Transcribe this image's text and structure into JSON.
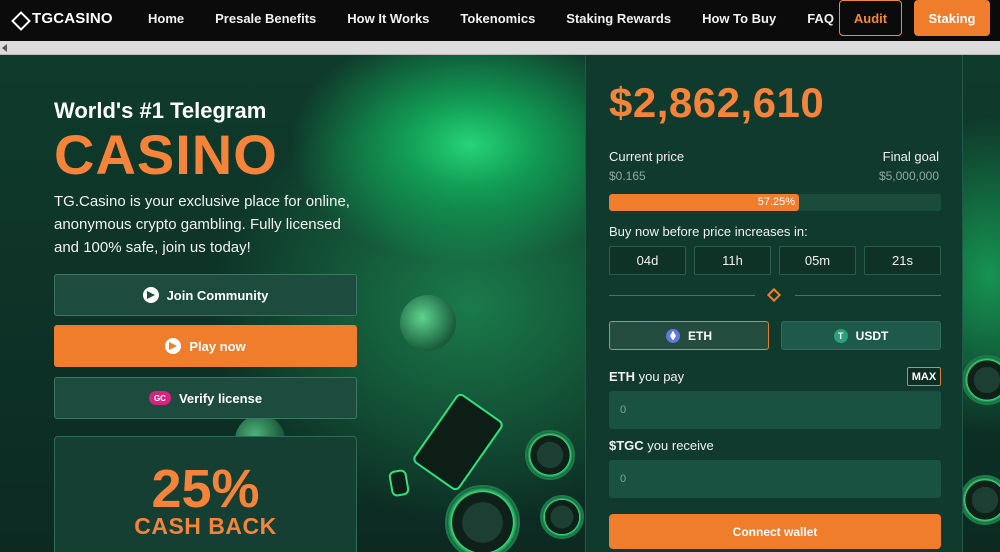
{
  "nav": {
    "logo": "TGCASINO",
    "links": [
      "Home",
      "Presale Benefits",
      "How It Works",
      "Tokenomics",
      "Staking Rewards",
      "How To Buy",
      "FAQ"
    ],
    "audit_label": "Audit",
    "staking_label": "Staking"
  },
  "hero": {
    "subtitle": "World's #1 Telegram",
    "title": "CASINO",
    "description": "TG.Casino is your exclusive place for online, anonymous crypto gambling. Fully licensed and 100% safe, join us today!",
    "join_label": "Join Community",
    "play_label": "Play now",
    "verify_label": "Verify license",
    "verify_icon_text": "GC",
    "cashback_pct": "25%",
    "cashback_text": "CASH BACK"
  },
  "presale": {
    "raised": "$2,862,610",
    "current_price_label": "Current price",
    "current_price": "$0.165",
    "final_goal_label": "Final goal",
    "final_goal": "$5,000,000",
    "progress_pct": 57.25,
    "progress_text": "57.25%",
    "buy_before_label": "Buy now before price increases in:",
    "countdown": [
      "04d",
      "11h",
      "05m",
      "21s"
    ],
    "tokens": [
      {
        "label": "ETH",
        "icon": "eth-icon"
      },
      {
        "label": "USDT",
        "icon": "usdt-icon"
      }
    ],
    "pay_token": "ETH",
    "pay_label": "you pay",
    "max_label": "MAX",
    "pay_placeholder": "0",
    "receive_token": "$TGC",
    "receive_label": "you receive",
    "receive_placeholder": "0",
    "connect_label": "Connect wallet"
  },
  "colors": {
    "accent": "#f07d2c",
    "panel": "#103a2d",
    "nav": "#0b0b0b"
  }
}
